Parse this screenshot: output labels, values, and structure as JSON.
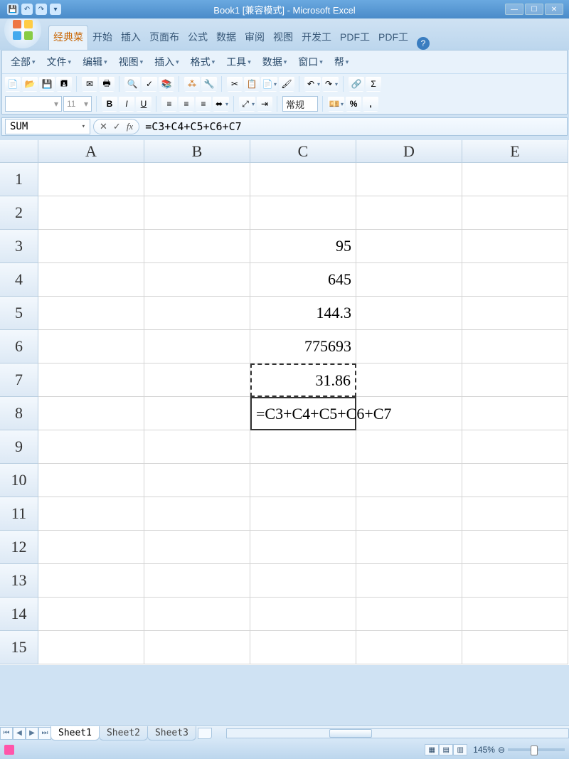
{
  "title": "Book1  [兼容模式] - Microsoft Excel",
  "ribbon_tabs": [
    "经典菜",
    "开始",
    "插入",
    "页面布",
    "公式",
    "数据",
    "审阅",
    "视图",
    "开发工",
    "PDF工",
    "PDF工"
  ],
  "active_tab_index": 0,
  "menus": [
    "全部",
    "文件",
    "编辑",
    "视图",
    "插入",
    "格式",
    "工具",
    "数据",
    "窗口",
    "帮"
  ],
  "font_name": "",
  "font_size": "11",
  "number_format": "常规",
  "name_box": "SUM",
  "formula": "=C3+C4+C5+C6+C7",
  "columns": [
    "A",
    "B",
    "C",
    "D",
    "E"
  ],
  "row_count": 15,
  "cells": {
    "C3": "95",
    "C4": "645",
    "C5": "144.3",
    "C6": "775693",
    "C7": "31.86",
    "C8": "=C3+C4+C5+C6+C7"
  },
  "marching_cell": "C7",
  "editing_cell": "C8",
  "sheet_tabs": [
    "Sheet1",
    "Sheet2",
    "Sheet3"
  ],
  "active_sheet": 0,
  "zoom": "145%"
}
